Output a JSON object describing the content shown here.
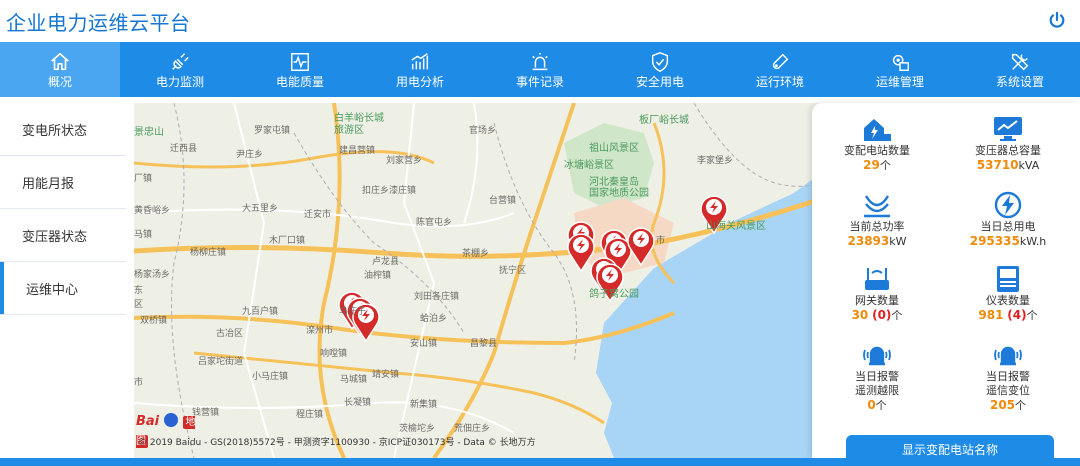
{
  "app": {
    "title": "企业电力运维云平台"
  },
  "nav": [
    {
      "label": "概况",
      "icon": "home-icon",
      "active": true
    },
    {
      "label": "电力监测",
      "icon": "plug-icon"
    },
    {
      "label": "电能质量",
      "icon": "waveform-icon"
    },
    {
      "label": "用电分析",
      "icon": "bar-chart-icon"
    },
    {
      "label": "事件记录",
      "icon": "alarm-light-icon"
    },
    {
      "label": "安全用电",
      "icon": "shield-check-icon"
    },
    {
      "label": "运行环境",
      "icon": "thermometer-icon"
    },
    {
      "label": "运维管理",
      "icon": "gear-doc-icon"
    },
    {
      "label": "系统设置",
      "icon": "tools-icon"
    }
  ],
  "sidebar": [
    {
      "label": "变电所状态"
    },
    {
      "label": "用能月报"
    },
    {
      "label": "变压器状态"
    },
    {
      "label": "运维中心",
      "active": true
    }
  ],
  "map": {
    "labels": [
      "景忠山",
      "罗家屯镇",
      "白羊峪长城",
      "旅游区",
      "官场乡",
      "迁西县",
      "尹庄乡",
      "建昌营镇",
      "刘家营乡",
      "祖山风景区",
      "冰塘峪景区",
      "河北秦皇岛",
      "国家地质公园",
      "板厂峪长城",
      "李家堡乡",
      "大五里乡",
      "迁安市",
      "扣庄乡",
      "漆庄镇",
      "台营镇",
      "陈官屯乡",
      "杨柳庄镇",
      "木厂口镇",
      "卢龙县",
      "茶棚乡",
      "抚宁区",
      "山海关风景区",
      "油榨镇",
      "市",
      "九百户镇",
      "马庄子",
      "刘田各庄镇",
      "蛤泊乡",
      "鸽子窝公园",
      "双桥镇",
      "古冶区",
      "滦州市",
      "响嘡镇",
      "安山镇",
      "昌黎县",
      "吕家坨街道",
      "小马庄镇",
      "马城镇",
      "靖安镇",
      "钱营镇",
      "程庄镇",
      "长凝镇",
      "新集镇",
      "荒佃庄乡",
      "茨榆坨乡",
      "厂镇",
      "黄昏峪乡",
      "马镇",
      "杨家汤乡",
      "东",
      "区",
      "市"
    ],
    "copyright": "© 2019 Baidu - GS(2018)5572号 - 甲测资字1100930 - 京ICP证030173号 - Data © 长地万方",
    "logo_text": "Bai",
    "logo_text2": "地图",
    "road_numbers": [
      "S53",
      "G1",
      "S52",
      "S51",
      "G0111"
    ],
    "markers": [
      "power-station-marker",
      "power-station-marker",
      "power-station-marker",
      "power-station-marker",
      "power-station-marker",
      "power-station-marker",
      "power-station-marker",
      "power-station-marker",
      "power-station-marker",
      "power-station-marker"
    ]
  },
  "stats": {
    "station_count": {
      "label": "变配电站数量",
      "value": "29",
      "unit": "个"
    },
    "transformer_capacity": {
      "label": "变压器总容量",
      "value": "53710",
      "unit": "kVA"
    },
    "total_power": {
      "label": "当前总功率",
      "value": "23893",
      "unit": "kW"
    },
    "daily_consumption": {
      "label": "当日总用电",
      "value": "295335",
      "unit": "kW.h"
    },
    "gateway_count": {
      "label": "网关数量",
      "value": "30",
      "alert": "(0)",
      "unit": "个"
    },
    "meter_count": {
      "label": "仪表数量",
      "value": "981",
      "alert": "(4)",
      "unit": "个"
    },
    "alarm_limit": {
      "label1": "当日报警",
      "label2": "遥测越限",
      "value": "0",
      "unit": "个"
    },
    "alarm_signal": {
      "label1": "当日报警",
      "label2": "遥信变位",
      "value": "205",
      "unit": "个"
    }
  },
  "button": {
    "label": "显示变配电站名称"
  },
  "colors": {
    "primary": "#1e8be6",
    "accent": "#f08a0a",
    "alert": "#e02020",
    "marker": "#d42a2a"
  }
}
